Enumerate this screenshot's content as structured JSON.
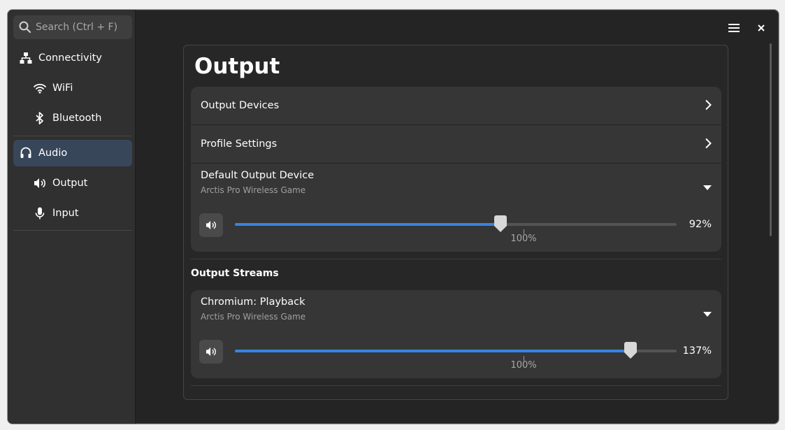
{
  "sidebar": {
    "search_placeholder": "Search (Ctrl + F)",
    "items": [
      {
        "label": "Connectivity",
        "icon": "network-icon"
      },
      {
        "label": "WiFi",
        "icon": "wifi-icon"
      },
      {
        "label": "Bluetooth",
        "icon": "bluetooth-icon"
      },
      {
        "label": "Audio",
        "icon": "headset-icon",
        "active": true
      },
      {
        "label": "Output",
        "icon": "speaker-icon"
      },
      {
        "label": "Input",
        "icon": "microphone-icon"
      }
    ]
  },
  "main": {
    "title": "Output",
    "rows": {
      "output_devices": "Output Devices",
      "profile_settings": "Profile Settings"
    },
    "default_device": {
      "title": "Default Output Device",
      "device": "Arctis Pro Wireless Game",
      "volume_percent": 92,
      "volume_label": "92%",
      "tick_label": "100%"
    },
    "streams_title": "Output Streams",
    "stream": {
      "title": "Chromium: Playback",
      "device": "Arctis Pro Wireless Game",
      "volume_percent": 137,
      "volume_label": "137%",
      "tick_label": "100%"
    },
    "slider_max_percent": 153
  },
  "colors": {
    "accent": "#3584e4",
    "active_nav": "#38465a"
  }
}
